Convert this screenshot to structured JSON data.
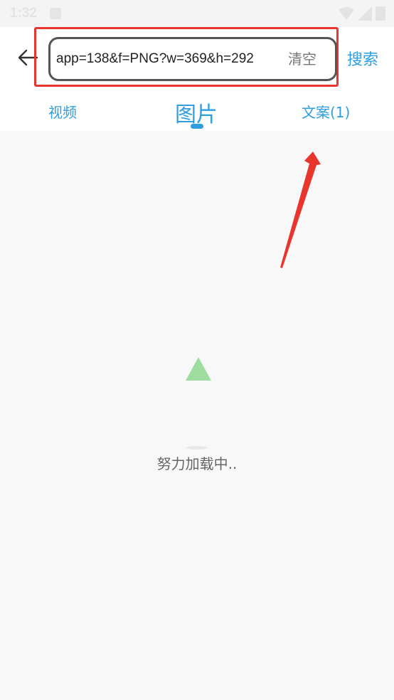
{
  "status_bar": {
    "time": "1:32"
  },
  "header": {
    "search_value": "app=138&f=PNG?w=369&h=292",
    "clear_label": "清空",
    "search_label": "搜索"
  },
  "tabs": [
    {
      "label": "视频",
      "active": false
    },
    {
      "label": "图片",
      "active": true
    },
    {
      "label": "文案(1)",
      "active": false
    }
  ],
  "loading": {
    "text": "努力加载中.."
  },
  "colors": {
    "accent": "#2f9ee0",
    "annotation": "#e8362f",
    "loader": "#9fdca0",
    "background": "#f8f8f8"
  },
  "icons": {
    "back": "arrow-left-icon",
    "wifi": "wifi-icon",
    "signal": "signal-icon",
    "battery": "battery-icon",
    "notification": "notification-icon"
  }
}
